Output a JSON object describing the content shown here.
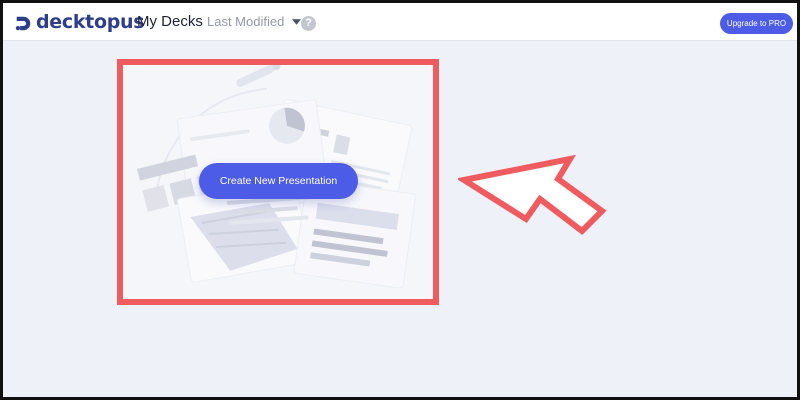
{
  "header": {
    "logo_text": "decktopus",
    "page_title": "My Decks",
    "sort_label": "Last Modified",
    "help_glyph": "?",
    "upgrade_label": "Upgrade to PRO"
  },
  "main": {
    "create_label": "Create New Presentation"
  },
  "icons": {
    "logo": "decktopus-logo-icon",
    "caret": "chevron-down-icon",
    "help": "help-circle-icon",
    "annotation": "pointer-arrow-annotation"
  },
  "colors": {
    "brand_navy": "#2f3e8c",
    "accent": "#4c5ce6",
    "page_background": "#eef1f8",
    "annotation_red": "#ef5b5e"
  }
}
